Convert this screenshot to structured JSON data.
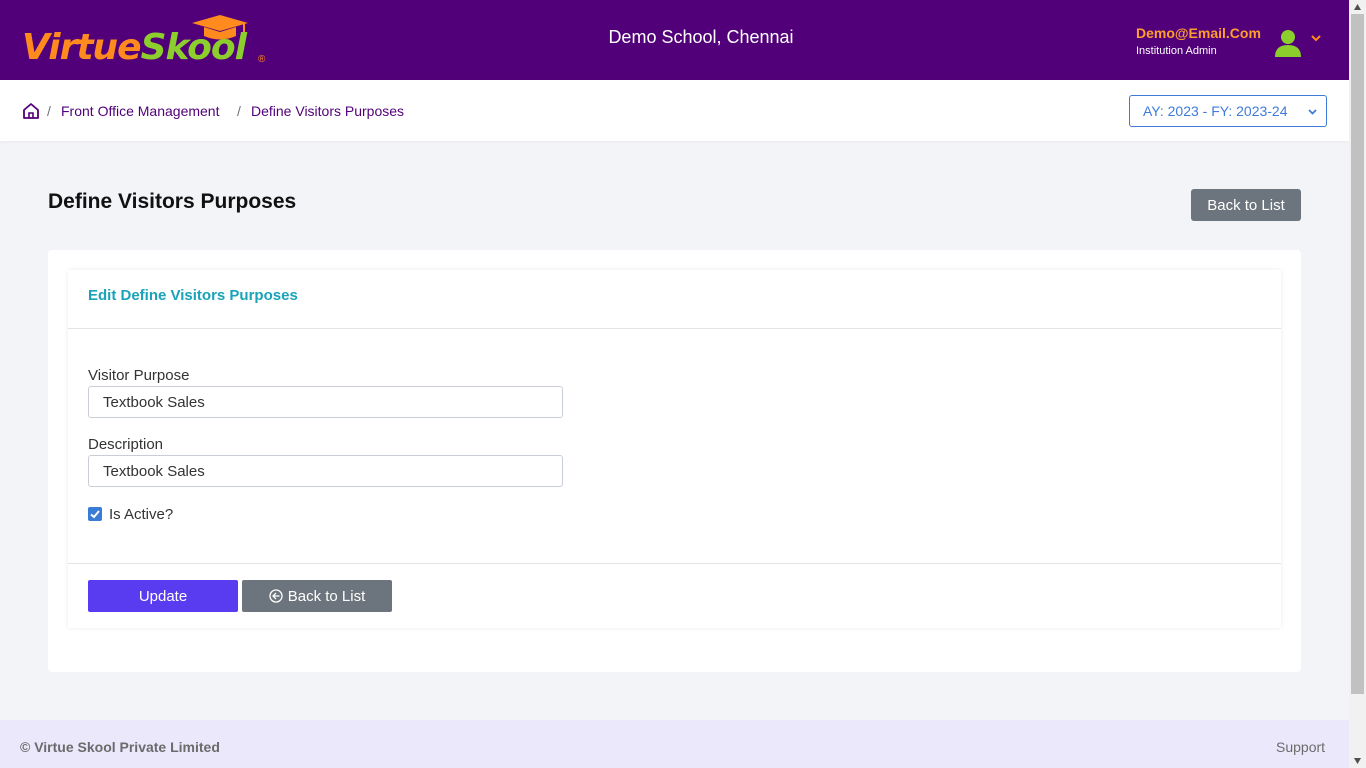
{
  "header": {
    "logo": {
      "part1": "Virtue",
      "part2": "Skool",
      "reg": "®"
    },
    "school_name": "Demo School, Chennai",
    "user": {
      "email": "Demo@Email.Com",
      "role": "Institution Admin"
    }
  },
  "breadcrumb": {
    "items": [
      "Front Office Management",
      "Define Visitors Purposes"
    ],
    "separator": "/"
  },
  "year_selector": {
    "value": "AY: 2023 - FY: 2023-24"
  },
  "page": {
    "title": "Define Visitors Purposes",
    "back_to_list_label": "Back to List"
  },
  "form": {
    "card_title": "Edit Define Visitors Purposes",
    "visitor_purpose": {
      "label": "Visitor Purpose",
      "value": "Textbook Sales"
    },
    "description": {
      "label": "Description",
      "value": "Textbook Sales"
    },
    "is_active": {
      "label": "Is Active?",
      "checked": true
    },
    "update_label": "Update",
    "back_label": "Back to List"
  },
  "footer": {
    "copyright": "© Virtue Skool Private Limited",
    "support": "Support"
  },
  "colors": {
    "header_bg": "#520079",
    "accent_orange": "#ff8a1e",
    "accent_green": "#8ccf2c",
    "primary_button": "#5a3cf0",
    "secondary_button": "#6c757d",
    "card_title": "#1aa3b8"
  },
  "icons": {
    "logo_cap": "graduation-cap-icon",
    "avatar": "user-avatar-icon",
    "user_menu": "chevron-down-icon",
    "home": "home-icon",
    "back": "circle-arrow-left-icon",
    "checkbox": "check-icon"
  }
}
